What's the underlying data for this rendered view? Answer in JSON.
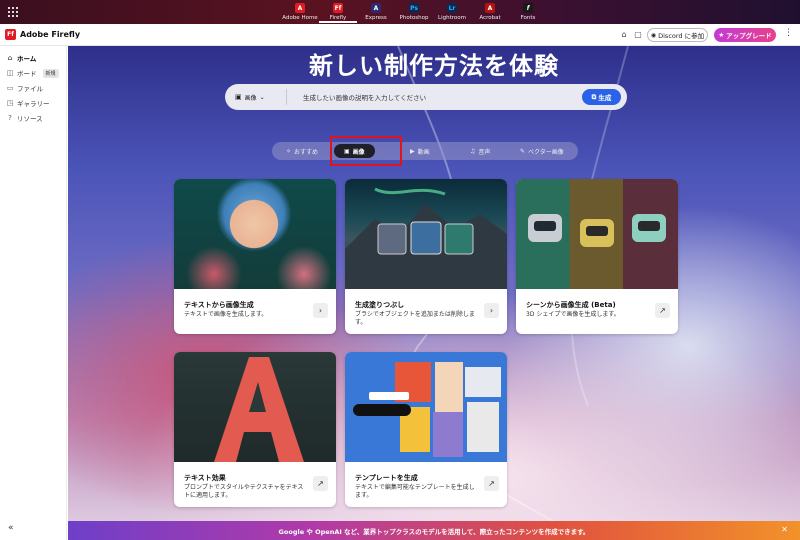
{
  "topbar": {
    "apps": [
      {
        "label": "Adobe Home",
        "icon": "adobe-icon",
        "glyph": "A",
        "color": "#e01b24"
      },
      {
        "label": "Firefly",
        "icon": "firefly-icon",
        "glyph": "Ff",
        "color": "#e01b24",
        "active": true
      },
      {
        "label": "Express",
        "icon": "express-icon",
        "glyph": "A",
        "color": "#2b2b6e"
      },
      {
        "label": "Photoshop",
        "icon": "photoshop-icon",
        "glyph": "Ps",
        "color": "#0b2a4f"
      },
      {
        "label": "Lightroom",
        "icon": "lightroom-icon",
        "glyph": "Lr",
        "color": "#0b2a4f"
      },
      {
        "label": "Acrobat",
        "icon": "acrobat-icon",
        "glyph": "A",
        "color": "#b3130f"
      },
      {
        "label": "Fonts",
        "icon": "fonts-icon",
        "glyph": "f",
        "color": "#1a1a1a"
      }
    ]
  },
  "header": {
    "logo": "Ff",
    "brand": "Adobe Firefly",
    "discord": "Discord に参加",
    "upgrade": "アップグレード"
  },
  "sidebar": {
    "items": [
      {
        "label": "ホーム",
        "icon": "home-icon",
        "active": true
      },
      {
        "label": "ボード",
        "icon": "board-icon",
        "badge": "新規"
      },
      {
        "label": "ファイル",
        "icon": "folder-icon"
      },
      {
        "label": "ギャラリー",
        "icon": "gallery-icon"
      },
      {
        "label": "リソース",
        "icon": "help-icon"
      }
    ]
  },
  "hero": {
    "title": "新しい制作方法を体験",
    "search_type": "画像",
    "placeholder": "生成したい画像の説明を入力してください",
    "generate": "生成"
  },
  "tabs": [
    {
      "label": "おすすめ"
    },
    {
      "label": "画像",
      "active": true
    },
    {
      "label": "動画"
    },
    {
      "label": "音声"
    },
    {
      "label": "ベクター画像"
    }
  ],
  "cards": [
    {
      "title": "テキストから画像生成",
      "desc": "テキストで画像を生成します。"
    },
    {
      "title": "生成塗りつぶし",
      "desc": "ブラシでオブジェクトを追加または削除します。"
    },
    {
      "title": "シーンから画像生成 (Beta)",
      "desc": "3D シェイプで画像を生成します。"
    },
    {
      "title": "テキスト効果",
      "desc": "プロンプトでスタイルやテクスチャをテキストに適用します。"
    },
    {
      "title": "テンプレートを生成",
      "desc": "テキストで編集可能なテンプレートを生成します。"
    }
  ],
  "banner": {
    "text": "Google や OpenAI など、業界トップクラスのモデルを活用して、際立ったコンテンツを作成できます。"
  }
}
